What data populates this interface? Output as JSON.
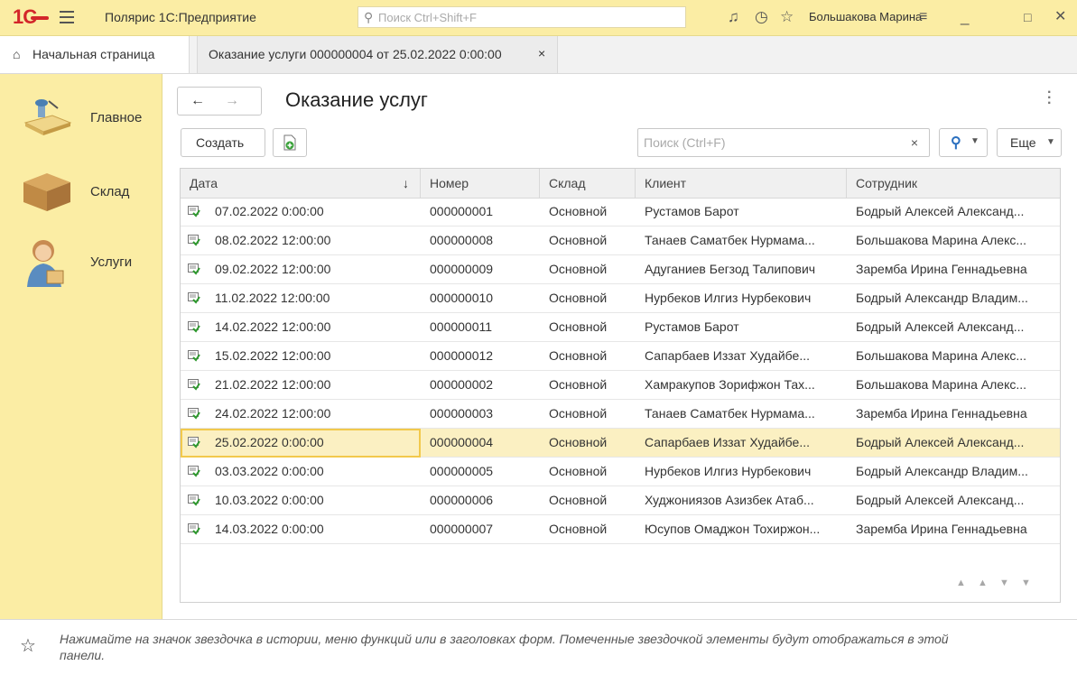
{
  "topbar": {
    "logo": "1С",
    "title": "Полярис 1С:Предприятие",
    "search_placeholder": "Поиск Ctrl+Shift+F",
    "user": "Большакова Марина"
  },
  "tabs": {
    "home": "Начальная страница",
    "doc": "Оказание услуги 000000004 от 25.02.2022 0:00:00",
    "close_glyph": "×"
  },
  "sidebar": {
    "items": [
      {
        "label": "Главное",
        "icon": "desk-lamp-icon"
      },
      {
        "label": "Склад",
        "icon": "box-icon"
      },
      {
        "label": "Услуги",
        "icon": "worker-icon"
      }
    ]
  },
  "main": {
    "title": "Оказание услуг",
    "create_label": "Создать",
    "search_placeholder": "Поиск (Ctrl+F)",
    "more_label": "Еще",
    "clear_glyph": "×"
  },
  "table": {
    "columns": [
      "Дата",
      "Номер",
      "Склад",
      "Клиент",
      "Сотрудник"
    ],
    "rows": [
      {
        "date": "07.02.2022 0:00:00",
        "num": "000000001",
        "wh": "Основной",
        "client": "Рустамов Барот",
        "emp": "Бодрый Алексей Александ..."
      },
      {
        "date": "08.02.2022 12:00:00",
        "num": "000000008",
        "wh": "Основной",
        "client": "Танаев Саматбек Нурмама...",
        "emp": "Большакова Марина Алекс..."
      },
      {
        "date": "09.02.2022 12:00:00",
        "num": "000000009",
        "wh": "Основной",
        "client": "Адуганиев Бегзод Талипович",
        "emp": "Заремба Ирина Геннадьевна"
      },
      {
        "date": "11.02.2022 12:00:00",
        "num": "000000010",
        "wh": "Основной",
        "client": "Нурбеков Илгиз Нурбекович",
        "emp": "Бодрый Александр Владим..."
      },
      {
        "date": "14.02.2022 12:00:00",
        "num": "000000011",
        "wh": "Основной",
        "client": "Рустамов Барот",
        "emp": "Бодрый Алексей Александ..."
      },
      {
        "date": "15.02.2022 12:00:00",
        "num": "000000012",
        "wh": "Основной",
        "client": "Сапарбаев Иззат Худайбе...",
        "emp": "Большакова Марина Алекс..."
      },
      {
        "date": "21.02.2022 12:00:00",
        "num": "000000002",
        "wh": "Основной",
        "client": "Хамракупов Зорифжон Тах...",
        "emp": "Большакова Марина Алекс..."
      },
      {
        "date": "24.02.2022 12:00:00",
        "num": "000000003",
        "wh": "Основной",
        "client": "Танаев Саматбек Нурмама...",
        "emp": "Заремба Ирина Геннадьевна"
      },
      {
        "date": "25.02.2022 0:00:00",
        "num": "000000004",
        "wh": "Основной",
        "client": "Сапарбаев Иззат Худайбе...",
        "emp": "Бодрый Алексей Александ...",
        "selected": true
      },
      {
        "date": "03.03.2022 0:00:00",
        "num": "000000005",
        "wh": "Основной",
        "client": "Нурбеков Илгиз Нурбекович",
        "emp": "Бодрый Александр Владим..."
      },
      {
        "date": "10.03.2022 0:00:00",
        "num": "000000006",
        "wh": "Основной",
        "client": "Худжониязов Азизбек Атаб...",
        "emp": "Бодрый Алексей Александ..."
      },
      {
        "date": "14.03.2022 0:00:00",
        "num": "000000007",
        "wh": "Основной",
        "client": "Юсупов Омаджон Тохиржон...",
        "emp": "Заремба Ирина Геннадьевна"
      }
    ]
  },
  "footer": {
    "hint": "Нажимайте на значок звездочка в истории, меню функций или в заголовках форм. Помеченные звездочкой элементы будут отображаться в этой панели."
  },
  "colors": {
    "panel_yellow": "#fbeda4",
    "selection": "#fbf0c2",
    "accent_blue": "#2a6fbf",
    "logo_red": "#d3262a"
  }
}
